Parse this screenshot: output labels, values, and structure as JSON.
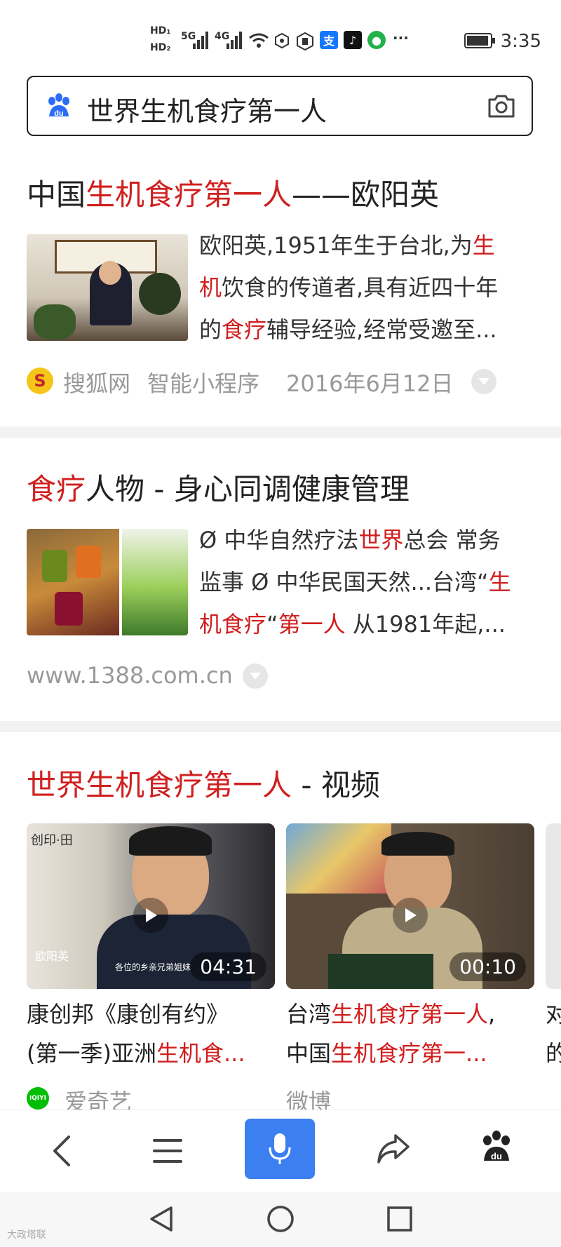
{
  "status_bar": {
    "hd1": "HD₁",
    "hd2": "HD₂",
    "net1": "5G",
    "net2": "4G",
    "more": "···",
    "time": "3:35",
    "alipay_glyph": "支"
  },
  "search": {
    "query": "世界生机食疗第一人",
    "logo_icon": "baidu-paw-icon",
    "camera_icon": "camera-icon"
  },
  "results": [
    {
      "title_parts": [
        "中国",
        "生机食疗第一人",
        "——欧阳英"
      ],
      "snippet": [
        [
          "欧阳英,1951年生于台北,为",
          "生"
        ],
        [
          "机",
          "饮食的传道者,具有近四十年"
        ],
        [
          "的",
          "食疗",
          "辅导经验,经常受邀至..."
        ]
      ],
      "source_logo": "S",
      "source": "搜狐网",
      "tag": "智能小程序",
      "date": "2016年6月12日"
    },
    {
      "title_parts": [
        "食疗",
        "人物 - 身心同调健康管理"
      ],
      "snippet": [
        [
          "Ø 中华自然疗法",
          "世界",
          "总会 常务"
        ],
        [
          "监事 Ø 中华民国天然...台湾“",
          "生"
        ],
        [
          "机食疗",
          "“",
          "第一人",
          " 从1981年起,..."
        ]
      ],
      "url": "www.1388.com.cn"
    }
  ],
  "video_section": {
    "title_parts": [
      "世界生机食疗第一人",
      " - 视频"
    ],
    "videos": [
      {
        "duration": "04:31",
        "overlay_brand": "创印·田",
        "overlay_name": "欧阳英",
        "overlay_sub": "各位的乡亲兄弟姐妹",
        "title_line1": [
          "康创邦《康创有约》"
        ],
        "title_line2": [
          "(第一季)亚洲",
          "生机食..."
        ],
        "source": "爱奇艺",
        "source_logo": "iQIYI"
      },
      {
        "duration": "00:10",
        "title_line1": [
          "台湾",
          "生机食疗第一人",
          ","
        ],
        "title_line2": [
          "中国",
          "生机食疗第一..."
        ],
        "source": "微博"
      }
    ],
    "partial_third": [
      "对",
      "的"
    ]
  },
  "toolbar": {
    "back_icon": "back-arrow-icon",
    "menu_icon": "menu-icon",
    "mic_icon": "microphone-icon",
    "share_icon": "share-icon",
    "baidu_icon": "baidu-paw-icon"
  },
  "watermark": "大政塔联",
  "colors": {
    "highlight": "#d01f1f",
    "mic_button": "#3b7ff0",
    "meta_grey": "#999999"
  }
}
